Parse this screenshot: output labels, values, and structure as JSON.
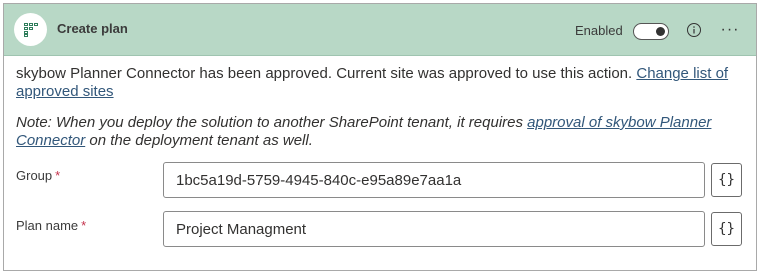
{
  "header": {
    "title": "Create plan",
    "enabled_label": "Enabled",
    "enabled": true,
    "app_icon": "planner-icon",
    "info_icon": "info-icon",
    "more_icon": "more-icon",
    "more_glyph": "···"
  },
  "message": {
    "text": "skybow Planner Connector has been approved. Current site was approved to use this action. ",
    "link": "Change list of approved sites"
  },
  "note": {
    "prefix": "Note: When you deploy the solution to another SharePoint tenant, it requires ",
    "link": "approval of skybow Planner Connector",
    "suffix": " on the deployment tenant as well."
  },
  "fields": {
    "group": {
      "label": "Group",
      "required_mark": "*",
      "value": "1bc5a19d-5759-4945-840c-e95a89e7aa1a",
      "expr_label": "{}"
    },
    "plan_name": {
      "label": "Plan name",
      "required_mark": "*",
      "value": "Project Managment",
      "expr_label": "{}"
    }
  },
  "colors": {
    "header_bg": "#b8d8c6",
    "link": "#32577a",
    "required": "#c4314b"
  }
}
